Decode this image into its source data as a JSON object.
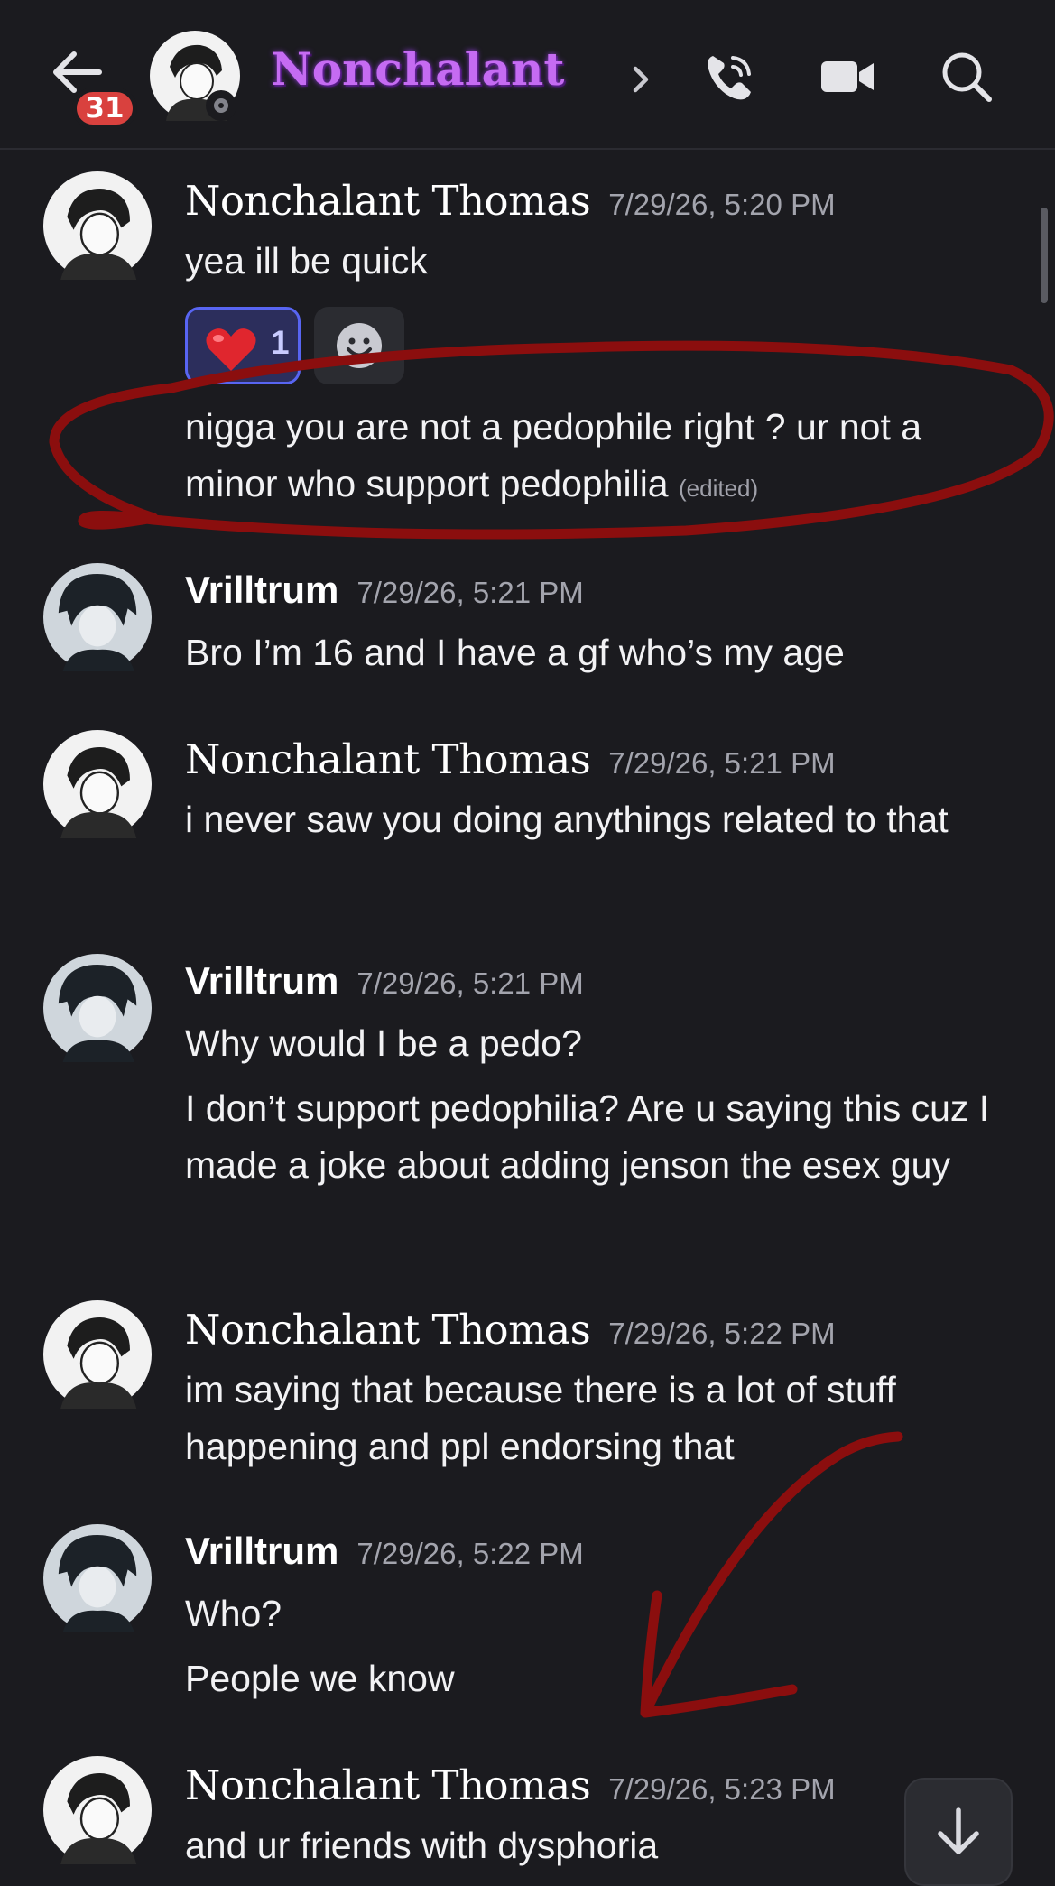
{
  "header": {
    "unread_badge": "31",
    "title": "Nonchalant"
  },
  "messages": [
    {
      "author": "Nonchalant Thomas",
      "timestamp": "7/29/26, 5:20 PM",
      "lines": [
        "yea ill be quick"
      ],
      "reactions": [
        {
          "emoji": "❤️",
          "count": "1"
        }
      ]
    },
    {
      "author": "Nonchalant Thomas",
      "lines": [
        "nigga you are not a pedophile right ? ur not a minor who support pedophilia"
      ],
      "edited_label": "(edited)"
    },
    {
      "author": "Vrilltrum",
      "timestamp": "7/29/26, 5:21 PM",
      "lines": [
        "Bro I’m 16 and I have a gf who’s my age"
      ]
    },
    {
      "author": "Nonchalant Thomas",
      "timestamp": "7/29/26, 5:21 PM",
      "lines": [
        "i never saw you doing anythings related to that"
      ]
    },
    {
      "author": "Vrilltrum",
      "timestamp": "7/29/26, 5:21 PM",
      "lines": [
        "Why would I be a pedo?",
        "I don’t support pedophilia? Are u saying this cuz I made a joke about adding jenson the esex guy"
      ]
    },
    {
      "author": "Nonchalant Thomas",
      "timestamp": "7/29/26, 5:22 PM",
      "lines": [
        "im saying that because there is a lot of stuff happening and ppl endorsing that"
      ]
    },
    {
      "author": "Vrilltrum",
      "timestamp": "7/29/26, 5:22 PM",
      "lines": [
        "Who?",
        "People we know"
      ]
    },
    {
      "author": "Nonchalant Thomas",
      "timestamp": "7/29/26, 5:23 PM",
      "lines": [
        "and ur friends with dysphoria"
      ]
    }
  ],
  "icons": {
    "back": "arrow-left-icon",
    "call": "phone-icon",
    "video": "video-camera-icon",
    "search": "search-icon",
    "jump": "arrow-down-icon"
  },
  "colors": {
    "background": "#1b1b1f",
    "title_purple": "#c56bf2",
    "badge_red": "#d9413e",
    "reaction_blurple": "#5865f2",
    "annotation_red": "#8b0e0e"
  }
}
